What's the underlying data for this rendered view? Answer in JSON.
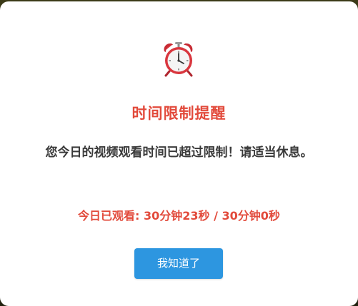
{
  "dialog": {
    "icon": "alarm-clock-icon",
    "title": "时间限制提醒",
    "message": "您今日的视频观看时间已超过限制！请适当休息。",
    "usage_label": "今日已观看: 30分钟23秒 / 30分钟0秒",
    "confirm_label": "我知道了"
  },
  "colors": {
    "accent_red": "#e24a3b",
    "button_blue": "#2d96e0",
    "text_dark": "#3a3a3a"
  }
}
